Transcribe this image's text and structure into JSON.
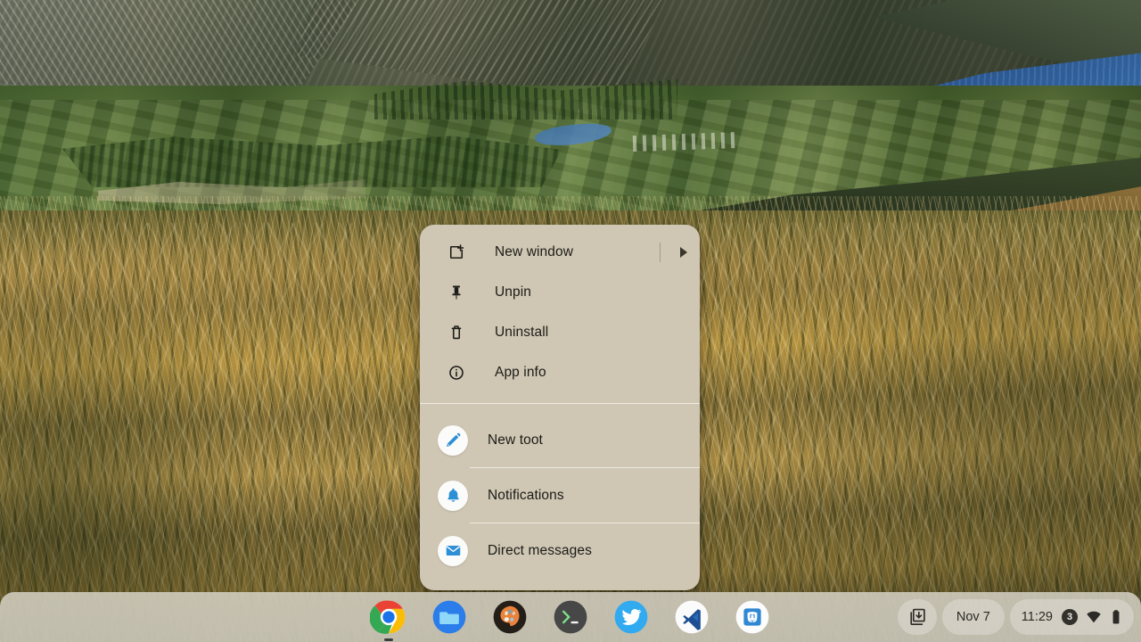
{
  "desktop": {
    "wallpaper_name": "lake-valley-tussock-grass-wallpaper",
    "accent_blue": "#2d8fd5",
    "menu_bg": "#cfc7b4",
    "shelf_bg": "#dedbd0"
  },
  "context_menu": {
    "name": "app-shelf-context-menu",
    "items": [
      {
        "id": "new-window",
        "label": "New window",
        "icon": "new-window-icon",
        "has_submenu": true,
        "submenu_arrow": "chevron-right-icon"
      },
      {
        "id": "unpin",
        "label": "Unpin",
        "icon": "pin-icon",
        "has_submenu": false
      },
      {
        "id": "uninstall",
        "label": "Uninstall",
        "icon": "trash-icon",
        "has_submenu": false
      },
      {
        "id": "app-info",
        "label": "App info",
        "icon": "info-icon",
        "has_submenu": false
      }
    ],
    "shortcuts": [
      {
        "id": "new-toot",
        "label": "New toot",
        "icon": "pencil-icon"
      },
      {
        "id": "notifications",
        "label": "Notifications",
        "icon": "bell-icon"
      },
      {
        "id": "direct-messages",
        "label": "Direct messages",
        "icon": "envelope-icon"
      }
    ]
  },
  "shelf": {
    "apps": [
      {
        "id": "chrome",
        "name": "chrome-app-icon",
        "active": true
      },
      {
        "id": "files",
        "name": "files-app-icon",
        "active": false
      },
      {
        "id": "art-app",
        "name": "art-app-icon",
        "active": false
      },
      {
        "id": "terminal",
        "name": "terminal-app-icon",
        "active": false
      },
      {
        "id": "twitter",
        "name": "twitter-app-icon",
        "active": false
      },
      {
        "id": "vscode",
        "name": "vscode-app-icon",
        "active": false
      },
      {
        "id": "mastodon",
        "name": "mastodon-app-icon",
        "active": false
      }
    ],
    "status": {
      "tote_icon": "downloads-tote-icon",
      "date": "Nov 7",
      "time": "11:29",
      "notification_count": "3",
      "wifi_icon": "wifi-icon",
      "battery_icon": "battery-icon"
    }
  }
}
